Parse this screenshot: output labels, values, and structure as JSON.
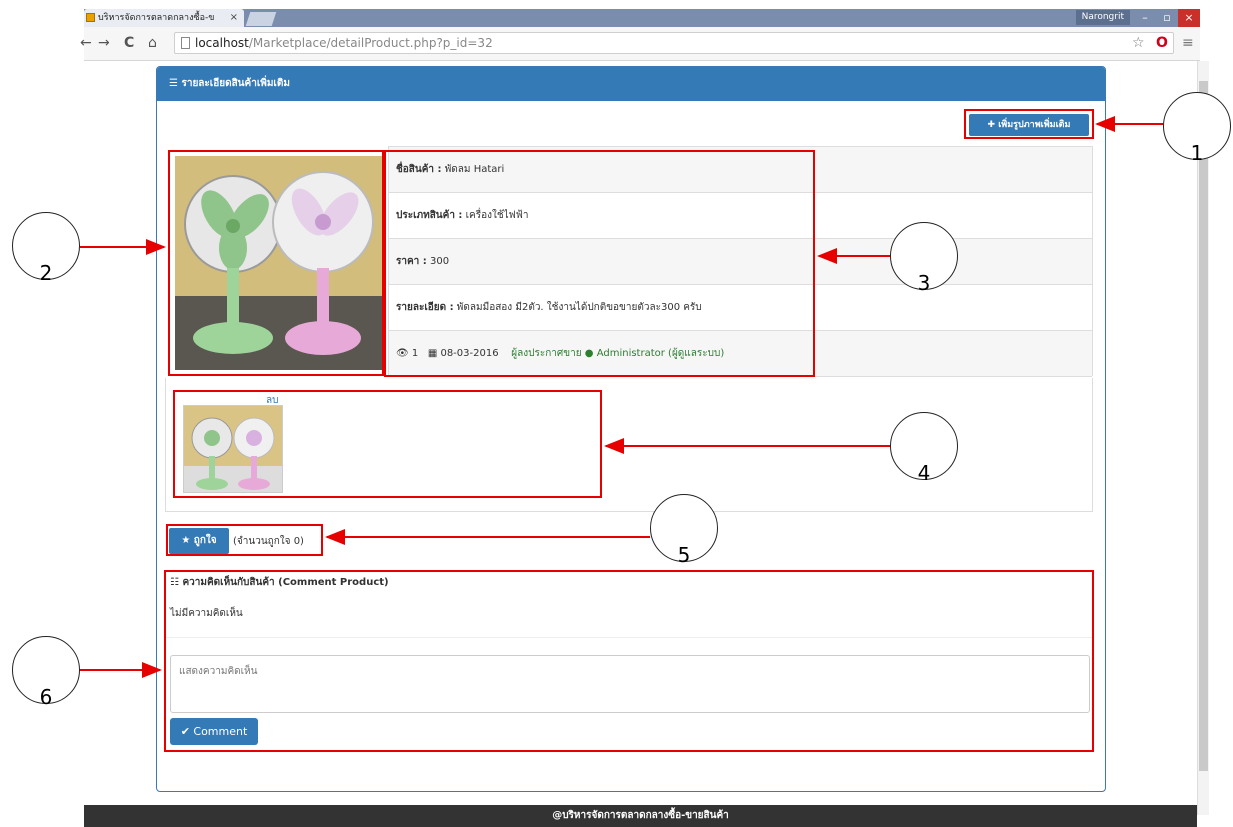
{
  "browser": {
    "tab_title": "บริหารจัดการตลาดกลางซื้อ-ข",
    "tab_close": "×",
    "user": "Narongrit",
    "url_host": "localhost",
    "url_path": "/Marketplace/detailProduct.php?p_id=32",
    "nav_back": "←",
    "nav_forward": "→",
    "reload": "C",
    "home": "⌂",
    "star": "☆",
    "opera": "O",
    "menu": "≡",
    "win_min": "–",
    "win_max": "▫",
    "win_close": "×"
  },
  "panel": {
    "heading": "รายละเอียดสินค้าเพิ่มเติม",
    "heading_icon": "list-icon",
    "add_image_label": "✚ เพิ่มรูปภาพเพิ่มเติม"
  },
  "product": {
    "name_label": "ชื่อสินค้า :",
    "name": "พัดลม Hatari",
    "type_label": "ประเภทสินค้า :",
    "type": "เครื่องใช้ไฟฟ้า",
    "price_label": "ราคา :",
    "price": "300",
    "detail_label": "รายละเอียด :",
    "detail": "พัดลมมือสอง มี2ตัว. ใช้งานได้ปกติขอขายตัวละ300 ครับ",
    "views": "1",
    "date": "08-03-2016",
    "seller_label": "ผู้ลงประกาศขาย",
    "seller": "Administrator (ผู้ดูแลระบบ)"
  },
  "thumbnail": {
    "delete_label": "ลบ"
  },
  "like": {
    "button_label": "★ ถูกใจ",
    "count_text": "(จำนวนถูกใจ 0)"
  },
  "comments": {
    "title": "ความคิดเห็นกับสินค้า (Comment Product)",
    "empty_text": "ไม่มีความคิดเห็น",
    "placeholder": "แสดงความคิดเห็น",
    "submit_label": "✔ Comment"
  },
  "footer": {
    "text": "@บริหารจัดการตลาดกลางซื้อ-ขายสินค้า"
  },
  "annotations": [
    "1",
    "2",
    "3",
    "4",
    "5",
    "6"
  ],
  "colors": {
    "primary": "#337ab7",
    "annotation": "#e60000",
    "footer": "#333333"
  }
}
